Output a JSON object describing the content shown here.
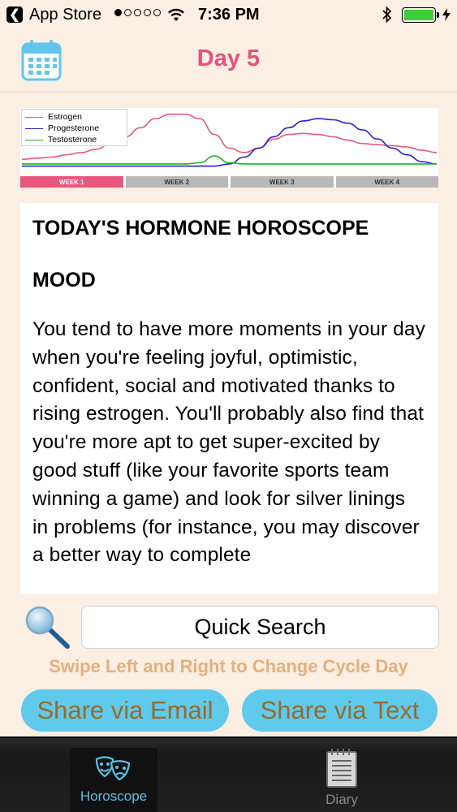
{
  "status_bar": {
    "back_glyph": "❮",
    "carrier": "App Store",
    "signal_bars_filled": 1,
    "signal_bars_total": 5,
    "time": "7:36 PM",
    "battery_level": 1.0,
    "icons": [
      "back-arrow-icon",
      "wifi-icon",
      "bluetooth-icon",
      "battery-icon",
      "charging-bolt-icon"
    ]
  },
  "nav": {
    "title": "Day 5",
    "title_color": "#e6507c",
    "left_icon": "calendar-icon"
  },
  "chart_data": {
    "type": "line",
    "x": [
      0,
      1,
      2,
      3,
      4,
      5,
      6,
      7,
      8,
      9,
      10,
      11,
      12,
      13,
      14,
      15,
      16,
      17,
      18,
      19,
      20,
      21,
      22,
      23,
      24,
      25,
      26,
      27,
      28
    ],
    "series": [
      {
        "name": "Estrogen",
        "color": "#e8587e",
        "values": [
          6,
          6.5,
          7,
          8,
          9,
          10.5,
          13,
          16,
          20,
          24,
          26,
          26,
          24,
          17,
          11,
          9,
          11,
          15,
          17,
          17.5,
          17,
          16,
          14.5,
          13,
          12.5,
          12,
          11.5,
          10,
          9
        ]
      },
      {
        "name": "Progesterone",
        "color": "#2e1fcf",
        "values": [
          3,
          3,
          3,
          3,
          3,
          3,
          3,
          3,
          3,
          3,
          3,
          3,
          3,
          3,
          4,
          7,
          11,
          16,
          20,
          23,
          24,
          23.5,
          22,
          19,
          15,
          11,
          8,
          5,
          4
        ]
      },
      {
        "name": "Testosterone",
        "color": "#21b521",
        "values": [
          4,
          4,
          4,
          4,
          4,
          4,
          4,
          4,
          4,
          4,
          4,
          4,
          4.5,
          7.5,
          4.5,
          4,
          4,
          4,
          4,
          4,
          4,
          4,
          4,
          4,
          4,
          4,
          4,
          4,
          4
        ]
      }
    ],
    "ylim": [
      0,
      28
    ],
    "legend": [
      "Estrogen",
      "Progesterone",
      "Testosterone"
    ],
    "legend_placement": "top-left",
    "weeks": [
      "WEEK 1",
      "WEEK 2",
      "WEEK 3",
      "WEEK 4"
    ],
    "active_week": 1,
    "current_day": 5
  },
  "horoscope": {
    "heading": "TODAY'S HORMONE HOROSCOPE",
    "section_title": "MOOD",
    "body": "You tend to have more moments in your day when you're feeling joyful, optimistic, confident, social and motivated thanks to rising estrogen. You'll probably also find that you're more apt to get super-excited by good stuff (like your favorite sports team winning a game) and look for silver linings in problems (for instance, you may discover a better way to complete"
  },
  "search": {
    "icon": "magnifying-glass-icon",
    "button_label": "Quick Search"
  },
  "hint": {
    "text": "Swipe Left and Right to Change Cycle Day",
    "color": "#e2b07d"
  },
  "share": {
    "email_label": "Share via Email",
    "text_label": "Share via Text",
    "button_color": "#5fcaec",
    "label_color": "#9a6a2b"
  },
  "tabs": [
    {
      "label": "Horoscope",
      "icon": "theater-masks-icon",
      "selected": true
    },
    {
      "label": "Diary",
      "icon": "notepad-icon",
      "selected": false
    }
  ],
  "colors": {
    "background": "#fbeee2",
    "active_tab": "#5cc2e8"
  }
}
